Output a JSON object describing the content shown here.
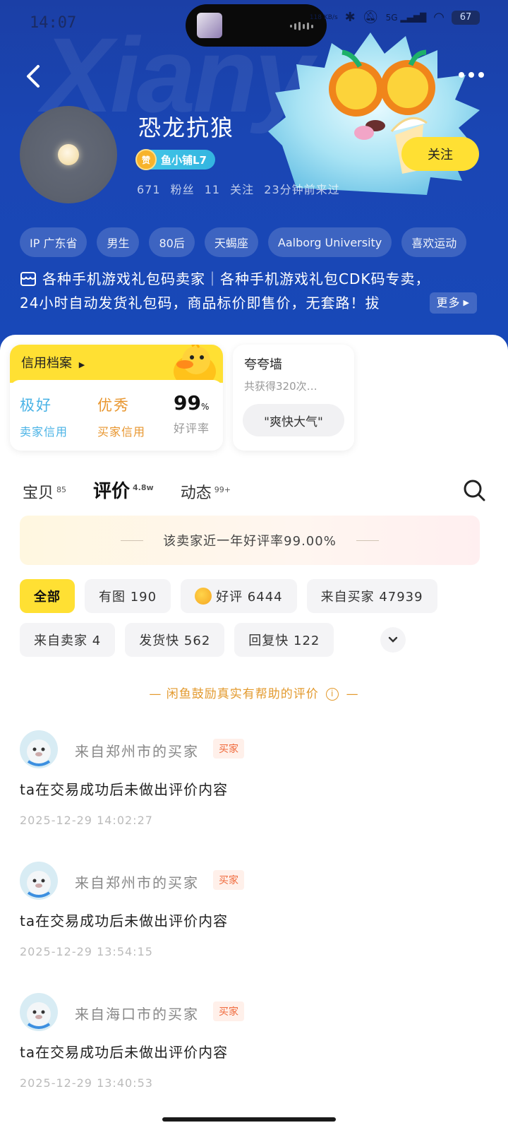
{
  "status_bar": {
    "time": "14:07",
    "net_speed": "118 KB/s",
    "signal_label": "5G",
    "battery": "67"
  },
  "profile": {
    "name": "恐龙抗狼",
    "badge_label": "鱼小铺L7",
    "badge_icon_text": "赞",
    "fans": "671 粉丝",
    "following": "11 关注",
    "last_seen": "23分钟前来过",
    "follow_label": "关注",
    "tags": [
      "IP 广东省",
      "男生",
      "80后",
      "天蝎座",
      "Aalborg University",
      "喜欢运动"
    ],
    "bio_line1": "各种手机游戏礼包码卖家｜各种手机游戏礼包CDK码专卖，",
    "bio_line2": "24小时自动发货礼包码，商品标价即售价，无套路！拔",
    "bio_more": "更多"
  },
  "credit": {
    "title": "信用档案",
    "seller_value": "极好",
    "seller_label": "卖家信用",
    "buyer_value": "优秀",
    "buyer_label": "买家信用",
    "rate_value": "99",
    "rate_unit": "%",
    "rate_label": "好评率",
    "colors": {
      "seller": "#4ab3e6",
      "buyer": "#e8962f"
    }
  },
  "praise": {
    "title": "夸夸墙",
    "subtitle": "共获得320次…",
    "pill": "\"爽快大气\""
  },
  "tabs": [
    {
      "label": "宝贝",
      "count": "85"
    },
    {
      "label": "评价",
      "count": "4.8w"
    },
    {
      "label": "动态",
      "count": "99+"
    }
  ],
  "rate_banner": "该卖家近一年好评率99.00%",
  "filters": {
    "row1": [
      "全部",
      "有图 190",
      "好评 6444",
      "来自买家 47939"
    ],
    "row2": [
      "来自卖家 4",
      "发货快 562",
      "回复快 122"
    ]
  },
  "encourage": {
    "text": "闲鱼鼓励真实有帮助的评价",
    "info_glyph": "i",
    "dash": "—"
  },
  "reviews": [
    {
      "user": "来自郑州市的买家",
      "tag": "买家",
      "content": "ta在交易成功后未做出评价内容",
      "time": "2025-12-29 14:02:27"
    },
    {
      "user": "来自郑州市的买家",
      "tag": "买家",
      "content": "ta在交易成功后未做出评价内容",
      "time": "2025-12-29 13:54:15"
    },
    {
      "user": "来自海口市的买家",
      "tag": "买家",
      "content": "ta在交易成功后未做出评价内容",
      "time": "2025-12-29 13:40:53"
    }
  ],
  "icons": {
    "back": "chevron-left-icon",
    "more": "more-dots-icon",
    "search": "search-icon",
    "expand": "chevron-down-icon",
    "bio": "shop-icon"
  },
  "accent_color": "#ffe033",
  "header_color": "#1a46b4"
}
